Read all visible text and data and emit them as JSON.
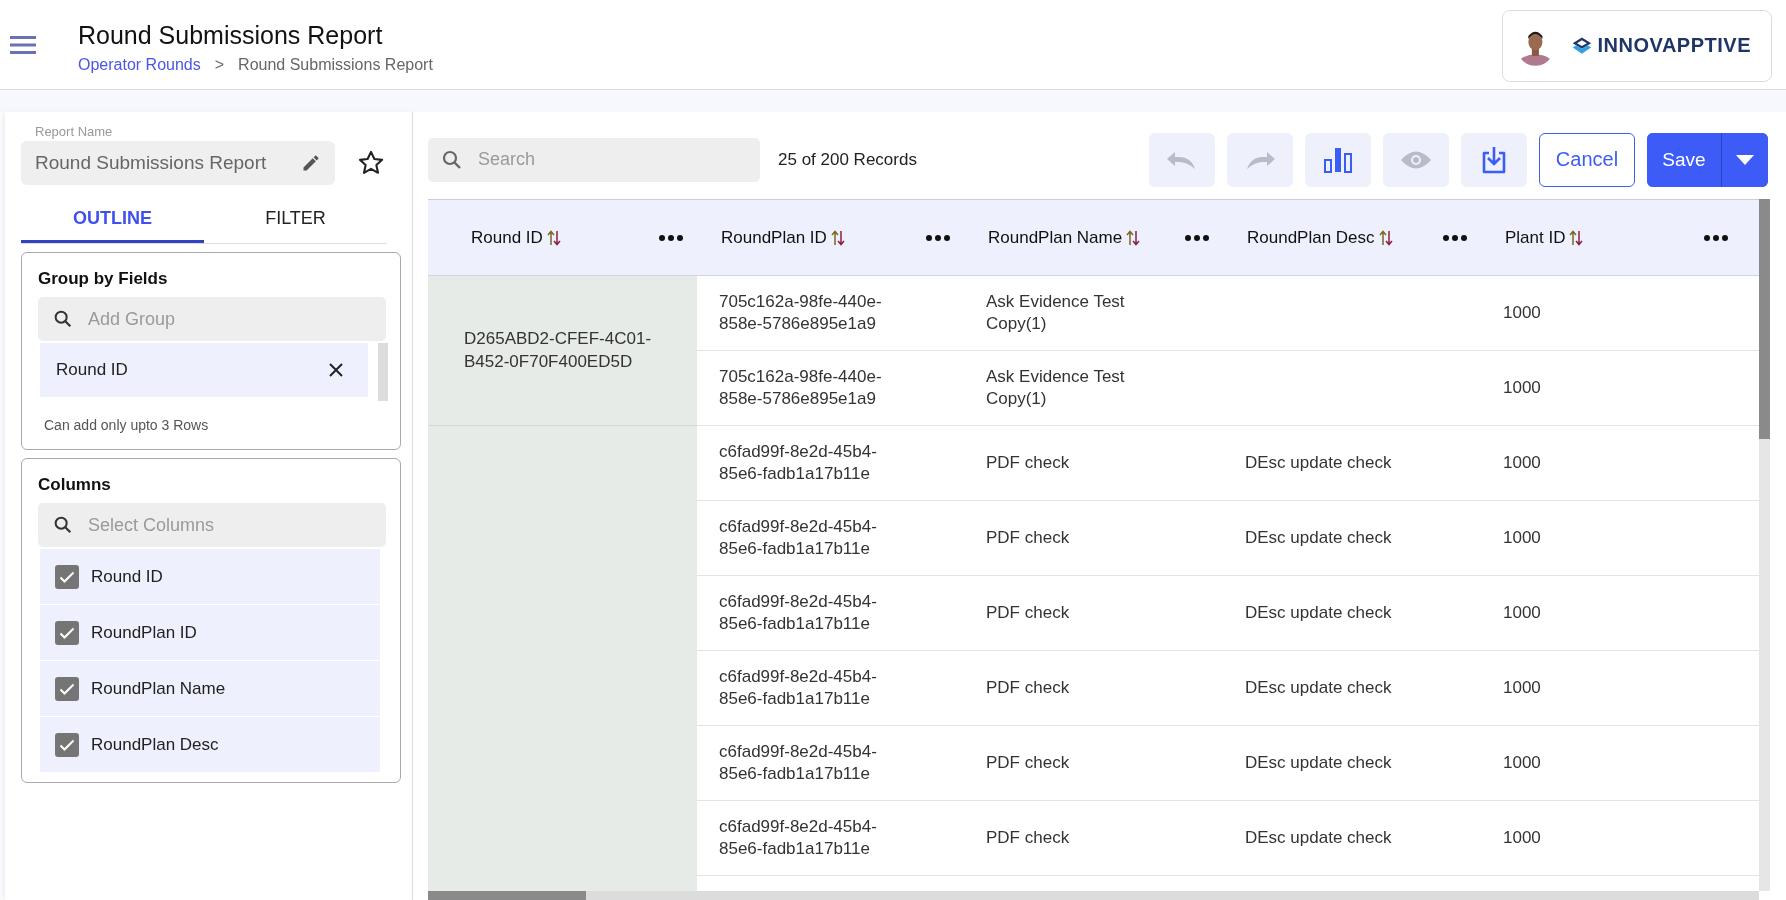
{
  "header": {
    "title": "Round Submissions Report",
    "breadcrumb": [
      {
        "label": "Operator Rounds",
        "kind": "link"
      },
      {
        "label": ">",
        "kind": "separator"
      },
      {
        "label": "Round Submissions Report",
        "kind": "current"
      }
    ],
    "brand": {
      "name": "INNOVAPPTIVE"
    }
  },
  "sidebar": {
    "report_name": {
      "label": "Report Name",
      "value": "Round Submissions Report"
    },
    "favorite": false,
    "tabs": [
      {
        "label": "OUTLINE",
        "selected": true
      },
      {
        "label": "FILTER",
        "selected": false
      }
    ],
    "group_by": {
      "title": "Group by Fields",
      "search": {
        "placeholder": "Add Group"
      },
      "items": [
        {
          "label": "Round ID"
        }
      ],
      "hint": "Can add only upto 3 Rows"
    },
    "columns": {
      "title": "Columns",
      "search": {
        "placeholder": "Select Columns"
      },
      "items": [
        {
          "label": "Round ID",
          "checked": true
        },
        {
          "label": "RoundPlan ID",
          "checked": true
        },
        {
          "label": "RoundPlan Name",
          "checked": true
        },
        {
          "label": "RoundPlan Desc",
          "checked": true
        }
      ]
    }
  },
  "toolbar": {
    "search": {
      "placeholder": "Search"
    },
    "records": "25 of 200 Records",
    "icon_buttons": [
      {
        "kind": "undo",
        "disabled": true
      },
      {
        "kind": "redo",
        "disabled": true
      },
      {
        "kind": "chart",
        "disabled": false
      },
      {
        "kind": "preview",
        "disabled": true
      },
      {
        "kind": "download",
        "disabled": false
      }
    ],
    "cancel": "Cancel",
    "save": "Save"
  },
  "table": {
    "columns": [
      "Round ID",
      "RoundPlan ID",
      "RoundPlan Name",
      "RoundPlan Desc",
      "Plant ID"
    ],
    "groups": [
      {
        "round_id": "D265ABD2-CFEF-4C01-B452-0F70F400ED5D",
        "rows": [
          {
            "roundplan_id": "705c162a-98fe-440e-858e-5786e895e1a9",
            "roundplan_name": "Ask Evidence Test Copy(1)",
            "plant_id": "1000"
          },
          {
            "roundplan_id": "705c162a-98fe-440e-858e-5786e895e1a9",
            "roundplan_name": "Ask Evidence Test Copy(1)",
            "plant_id": "1000"
          }
        ]
      },
      {
        "rows": [
          {
            "roundplan_id": "c6fad99f-8e2d-45b4-85e6-fadb1a17b11e",
            "roundplan_name": "PDF check",
            "roundplan_desc": "DEsc update check",
            "plant_id": "1000"
          },
          {
            "roundplan_id": "c6fad99f-8e2d-45b4-85e6-fadb1a17b11e",
            "roundplan_name": "PDF check",
            "roundplan_desc": "DEsc update check",
            "plant_id": "1000"
          },
          {
            "roundplan_id": "c6fad99f-8e2d-45b4-85e6-fadb1a17b11e",
            "roundplan_name": "PDF check",
            "roundplan_desc": "DEsc update check",
            "plant_id": "1000"
          },
          {
            "roundplan_id": "c6fad99f-8e2d-45b4-85e6-fadb1a17b11e",
            "roundplan_name": "PDF check",
            "roundplan_desc": "DEsc update check",
            "plant_id": "1000"
          },
          {
            "roundplan_id": "c6fad99f-8e2d-45b4-85e6-fadb1a17b11e",
            "roundplan_name": "PDF check",
            "roundplan_desc": "DEsc update check",
            "plant_id": "1000"
          },
          {
            "roundplan_id": "c6fad99f-8e2d-45b4-85e6-fadb1a17b11e",
            "roundplan_name": "PDF check",
            "roundplan_desc": "DEsc update check",
            "plant_id": "1000"
          }
        ]
      }
    ]
  }
}
